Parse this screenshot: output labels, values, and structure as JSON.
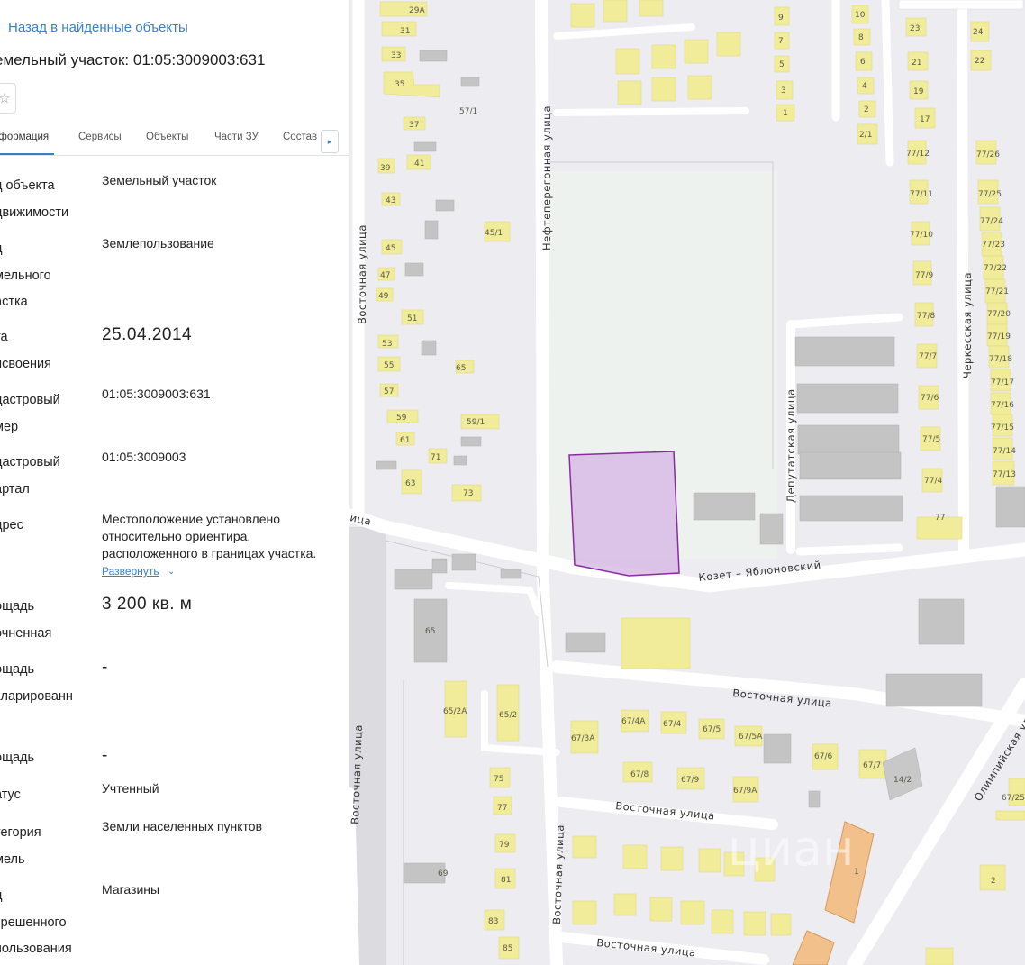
{
  "panel": {
    "back_link": "Назад в найденные объекты",
    "title": "емельный участок: 01:05:3009003:631",
    "star": "☆",
    "tabs": [
      "нформация",
      "Сервисы",
      "Объекты",
      "Части ЗУ",
      "Состав"
    ],
    "tab_arrow": "▸",
    "rows": [
      {
        "label": "д объекта\nдвижимости",
        "value": "Земельный участок"
      },
      {
        "label": "д\nмельного\nастка",
        "value": "Землепользование"
      },
      {
        "label": "та\nисвоения",
        "value": "25.04.2014"
      },
      {
        "label": "дастровый\nмер",
        "value": "01:05:3009003:631"
      },
      {
        "label": "дастровый\nартал",
        "value": "01:05:3009003"
      },
      {
        "label": "дрес",
        "value": "Местоположение установлено\nотносительно ориентира,\nрасположенного в границах участка."
      },
      {
        "label": "ощадь\nочненная",
        "value": "3 200 кв. м"
      },
      {
        "label": "ощадь\nкларированн",
        "value": "-"
      },
      {
        "label": "ощадь",
        "value": "-"
      },
      {
        "label": "атус",
        "value": "Учтенный"
      },
      {
        "label": "тегория\nмель",
        "value": "Земли населенных пунктов"
      },
      {
        "label": "д\nзрешенного\nпользования",
        "value": "Магазины"
      }
    ],
    "expand_link": "Развернуть",
    "expand_icon": "chevron-down"
  },
  "map": {
    "colors": {
      "background": "#ececf1",
      "house": "#f1ec9a",
      "building": "#c4c4c4",
      "parcel_fill": "#d8bce6",
      "parcel_stroke": "#8a2aa0",
      "road": "#ffffff"
    },
    "streets": {
      "neft": "Нефтеперегонная улица",
      "vost_left": "Восточная улица",
      "vost_cut": "ица",
      "kozet": "Козет – Яблоновский",
      "vost_mid": "Восточная улица",
      "vost_low": "Восточная улица",
      "vost_bottom": "Восточная улица",
      "vost_vert": "Восточная улица",
      "vost_vert2": "Восточная улица",
      "deput": "Депутатская улица",
      "cherk": "Черкесская улица",
      "olymp": "Олимпийская улица"
    },
    "house_numbers": {
      "h29a": "29А",
      "h31": "31",
      "h33": "33",
      "h35": "35",
      "h37": "37",
      "h39": "39",
      "h41": "41",
      "h43": "43",
      "h45": "45",
      "h47": "47",
      "h49": "49",
      "h51": "51",
      "h53": "53",
      "h55": "55",
      "h57": "57",
      "h59": "59",
      "h61": "61",
      "h63": "63",
      "h71": "71",
      "h73": "73",
      "h65a": "65",
      "h59_1": "59/1",
      "h45_1": "45/1",
      "h57_1": "57/1",
      "h9": "9",
      "h7": "7",
      "h5": "5",
      "h3": "3",
      "h1": "1",
      "h10": "10",
      "h8": "8",
      "h6": "6",
      "h4": "4",
      "h2": "2",
      "h2_1": "2/1",
      "h23": "23",
      "h21": "21",
      "h19": "19",
      "h17": "17",
      "h24": "24",
      "h22": "22",
      "h77_12": "77/12",
      "h77_11": "77/11",
      "h77_10": "77/10",
      "h77_9": "77/9",
      "h77_8": "77/8",
      "h77_7": "77/7",
      "h77_6": "77/6",
      "h77_5": "77/5",
      "h77_4": "77/4",
      "h77": "77",
      "h77_26": "77/26",
      "h77_25": "77/25",
      "h77_24": "77/24",
      "h77_23": "77/23",
      "h77_22": "77/22",
      "h77_21": "77/21",
      "h77_20": "77/20",
      "h77_19": "77/19",
      "h77_18": "77/18",
      "h77_17": "77/17",
      "h77_16": "77/16",
      "h77_15": "77/15",
      "h77_14": "77/14",
      "h77_13": "77/13",
      "h65": "65",
      "h65_2a": "65/2А",
      "h65_2": "65/2",
      "h75": "75",
      "h77b": "77",
      "h79": "79",
      "h81": "81",
      "h83": "83",
      "h85": "85",
      "h69": "69",
      "h67_3a": "67/3А",
      "h67_4a": "67/4А",
      "h67_4": "67/4",
      "h67_5": "67/5",
      "h67_5a": "67/5А",
      "h67_6": "67/6",
      "h67_7": "67/7",
      "h67_8": "67/8",
      "h67_9": "67/9",
      "h67_9a": "67/9А",
      "h14_2": "14/2",
      "h1b": "1",
      "h2b": "2",
      "h67_2x": "67/25"
    },
    "watermark": "циан"
  }
}
